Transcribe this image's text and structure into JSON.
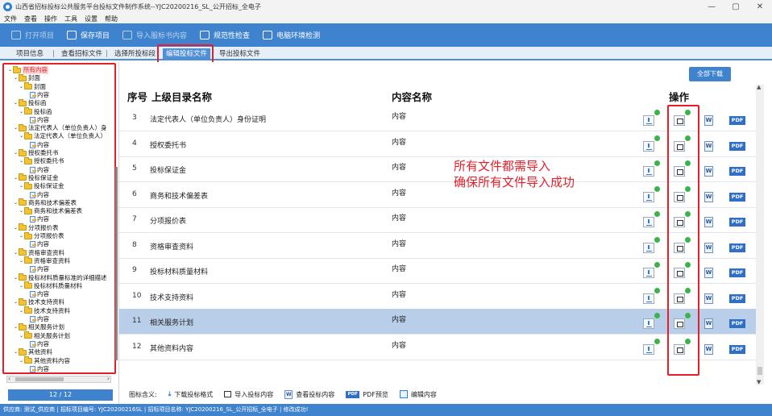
{
  "window": {
    "title": "山西省招标投标公共服务平台投标文件制作系统--YJC20200216_SL_公开招标_全电子",
    "controls": [
      "—",
      "▢",
      "✕"
    ]
  },
  "menu": [
    "文件",
    "查看",
    "操作",
    "工具",
    "设置",
    "帮助"
  ],
  "toolbar": [
    {
      "label": "打开项目",
      "icon": "open-icon",
      "enabled": false
    },
    {
      "label": "保存项目",
      "icon": "save-icon",
      "enabled": true
    },
    {
      "label": "导入服标书内容",
      "icon": "import-icon",
      "enabled": false
    },
    {
      "label": "规范性检查",
      "icon": "check-icon",
      "enabled": true
    },
    {
      "label": "电脑环境检测",
      "icon": "monitor-icon",
      "enabled": true
    }
  ],
  "tabs": [
    {
      "label": "项目信息",
      "active": false
    },
    {
      "label": "查看招标文件",
      "active": false
    },
    {
      "label": "选择所投标段",
      "active": false
    },
    {
      "label": "编辑投标文件",
      "active": true
    },
    {
      "label": "导出投标文件",
      "active": false
    }
  ],
  "tree": [
    {
      "label": "所有内容",
      "level": 0,
      "type": "folder",
      "selected": true
    },
    {
      "label": "封面",
      "level": 1,
      "type": "folder"
    },
    {
      "label": "封面",
      "level": 2,
      "type": "folder"
    },
    {
      "label": "内容",
      "level": 3,
      "type": "doc"
    },
    {
      "label": "投标函",
      "level": 1,
      "type": "folder"
    },
    {
      "label": "投标函",
      "level": 2,
      "type": "folder"
    },
    {
      "label": "内容",
      "level": 3,
      "type": "doc"
    },
    {
      "label": "法定代表人（单位负责人）身",
      "level": 1,
      "type": "folder"
    },
    {
      "label": "法定代表人（单位负责人）",
      "level": 2,
      "type": "folder"
    },
    {
      "label": "内容",
      "level": 3,
      "type": "doc"
    },
    {
      "label": "授权委托书",
      "level": 1,
      "type": "folder"
    },
    {
      "label": "授权委托书",
      "level": 2,
      "type": "folder"
    },
    {
      "label": "内容",
      "level": 3,
      "type": "doc"
    },
    {
      "label": "投标保证金",
      "level": 1,
      "type": "folder"
    },
    {
      "label": "投标保证金",
      "level": 2,
      "type": "folder"
    },
    {
      "label": "内容",
      "level": 3,
      "type": "doc"
    },
    {
      "label": "商务和技术偏差表",
      "level": 1,
      "type": "folder"
    },
    {
      "label": "商务和技术偏差表",
      "level": 2,
      "type": "folder"
    },
    {
      "label": "内容",
      "level": 3,
      "type": "doc"
    },
    {
      "label": "分项报价表",
      "level": 1,
      "type": "folder"
    },
    {
      "label": "分项报价表",
      "level": 2,
      "type": "folder"
    },
    {
      "label": "内容",
      "level": 3,
      "type": "doc"
    },
    {
      "label": "资格审查资料",
      "level": 1,
      "type": "folder"
    },
    {
      "label": "资格审查资料",
      "level": 2,
      "type": "folder"
    },
    {
      "label": "内容",
      "level": 3,
      "type": "doc"
    },
    {
      "label": "投标材料质量标准的详细描述",
      "level": 1,
      "type": "folder"
    },
    {
      "label": "投标材料质量材料",
      "level": 2,
      "type": "folder"
    },
    {
      "label": "内容",
      "level": 3,
      "type": "doc"
    },
    {
      "label": "技术支持资料",
      "level": 1,
      "type": "folder"
    },
    {
      "label": "技术支持资料",
      "level": 2,
      "type": "folder"
    },
    {
      "label": "内容",
      "level": 3,
      "type": "doc"
    },
    {
      "label": "相关服务计划",
      "level": 1,
      "type": "folder"
    },
    {
      "label": "相关服务计划",
      "level": 2,
      "type": "folder"
    },
    {
      "label": "内容",
      "level": 3,
      "type": "doc"
    },
    {
      "label": "其他资料",
      "level": 1,
      "type": "folder"
    },
    {
      "label": "其他资料内容",
      "level": 2,
      "type": "folder"
    },
    {
      "label": "内容",
      "level": 3,
      "type": "doc"
    }
  ],
  "pager": {
    "text": "12 / 12"
  },
  "main": {
    "download_all": "全部下载",
    "headers": {
      "seq": "序号",
      "parent": "上级目录名称",
      "content": "内容名称",
      "ops": "操作"
    },
    "rows": [
      {
        "seq": "3",
        "parent": "法定代表人（单位负责人）身份证明",
        "content": "内容",
        "selected": false
      },
      {
        "seq": "4",
        "parent": "授权委托书",
        "content": "内容",
        "selected": false
      },
      {
        "seq": "5",
        "parent": "投标保证金",
        "content": "内容",
        "selected": false
      },
      {
        "seq": "6",
        "parent": "商务和技术偏差表",
        "content": "内容",
        "selected": false
      },
      {
        "seq": "7",
        "parent": "分项报价表",
        "content": "内容",
        "selected": false
      },
      {
        "seq": "8",
        "parent": "资格审查资料",
        "content": "内容",
        "selected": false
      },
      {
        "seq": "9",
        "parent": "投标材料质量材料",
        "content": "内容",
        "selected": false
      },
      {
        "seq": "10",
        "parent": "技术支持资料",
        "content": "内容",
        "selected": false
      },
      {
        "seq": "11",
        "parent": "相关服务计划",
        "content": "内容",
        "selected": true
      },
      {
        "seq": "12",
        "parent": "其他资料内容",
        "content": "内容",
        "selected": false
      }
    ],
    "word_glyph": "W",
    "pdf_glyph": "PDF",
    "annotation": [
      "所有文件都需导入",
      "确保所有文件导入成功"
    ]
  },
  "legend": {
    "title": "图标含义:",
    "items": [
      "下载投标格式",
      "导入投标内容",
      "查看投标内容",
      "PDF预览",
      "编辑内容"
    ]
  },
  "statusbar": "供应商: 测试_供应商  |  招标项目编号: YJC20200216SL  |  招标项目名称: YJC20200216_SL_公开招标_全电子  |  修改成功!",
  "colors": {
    "accent": "#3f83cf",
    "highlight_red": "#e3202a",
    "selected_row": "#b9cfe9",
    "ok_green": "#3bb34a"
  }
}
